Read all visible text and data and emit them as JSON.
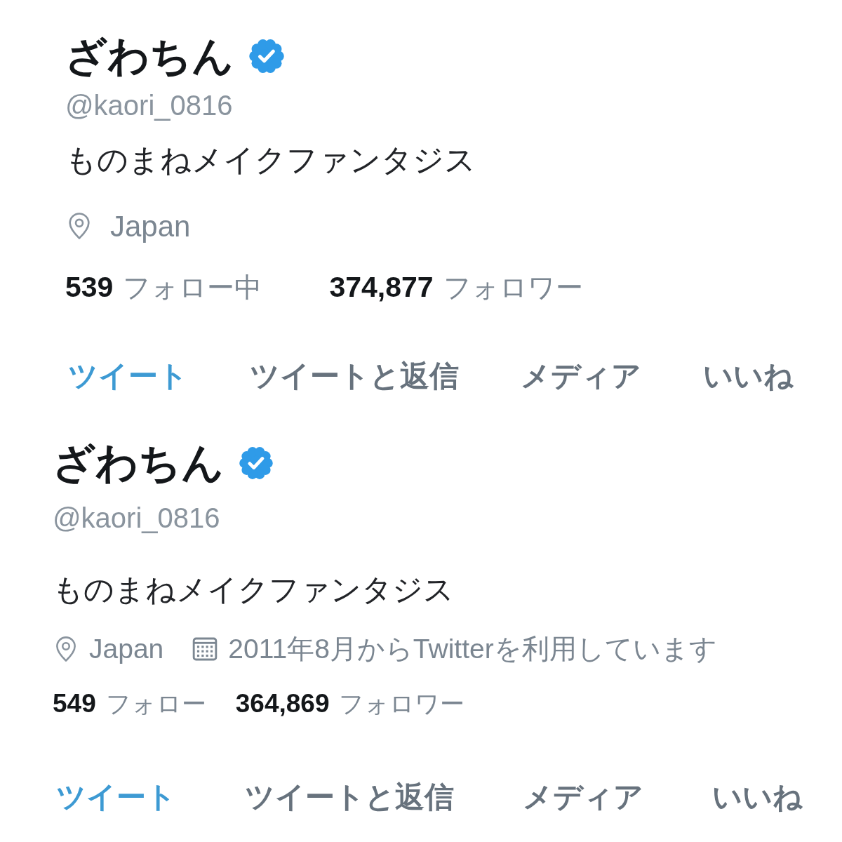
{
  "profiles": [
    {
      "name": "ざわちん",
      "verified": true,
      "handle": "@kaori_0816",
      "bio": "ものまねメイクファンタジス",
      "meta": [
        {
          "kind": "location",
          "text": "Japan"
        }
      ],
      "stats": [
        {
          "count": "539",
          "label": "フォロー中"
        },
        {
          "count": "374,877",
          "label": "フォロワー"
        }
      ],
      "tabs": [
        {
          "label": "ツイート",
          "selected": true
        },
        {
          "label": "ツイートと返信",
          "selected": false
        },
        {
          "label": "メディア",
          "selected": false
        },
        {
          "label": "いいね",
          "selected": false
        }
      ]
    },
    {
      "name": "ざわちん",
      "verified": true,
      "handle": "@kaori_0816",
      "bio": "ものまねメイクファンタジス",
      "meta": [
        {
          "kind": "location",
          "text": "Japan"
        },
        {
          "kind": "joined",
          "text": "2011年8月からTwitterを利用しています"
        }
      ],
      "stats": [
        {
          "count": "549",
          "label": "フォロー"
        },
        {
          "count": "364,869",
          "label": "フォロワー"
        }
      ],
      "tabs": [
        {
          "label": "ツイート",
          "selected": true
        },
        {
          "label": "ツイートと返信",
          "selected": false
        },
        {
          "label": "メディア",
          "selected": false
        },
        {
          "label": "いいね",
          "selected": false
        }
      ]
    }
  ]
}
